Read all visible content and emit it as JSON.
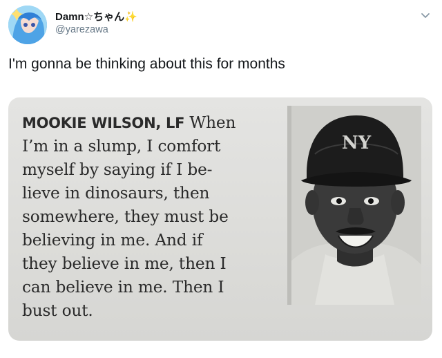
{
  "tweet": {
    "author": {
      "display_name": "Damn☆ちゃん",
      "sparkle": "✨",
      "handle": "@yarezawa",
      "avatar_icon": "anime-avatar"
    },
    "menu_icon": "chevron-down-icon",
    "text": "I'm gonna be thinking about this for months",
    "media": {
      "clipping": {
        "name": "MOOKIE WILSON, LF",
        "first_line_rest": "When",
        "lines": [
          "I’m in a slump, I comfort",
          "myself by saying if I be-",
          "lieve in dinosaurs, then",
          "somewhere, they must be",
          "believing in me. And if",
          "they believe in me, then I",
          "can believe in me. Then I",
          "bust out."
        ]
      },
      "photo_icon": "player-portrait"
    }
  },
  "colors": {
    "text": "#14171a",
    "secondary": "#657786",
    "newsprint": "#dcdcd9"
  }
}
